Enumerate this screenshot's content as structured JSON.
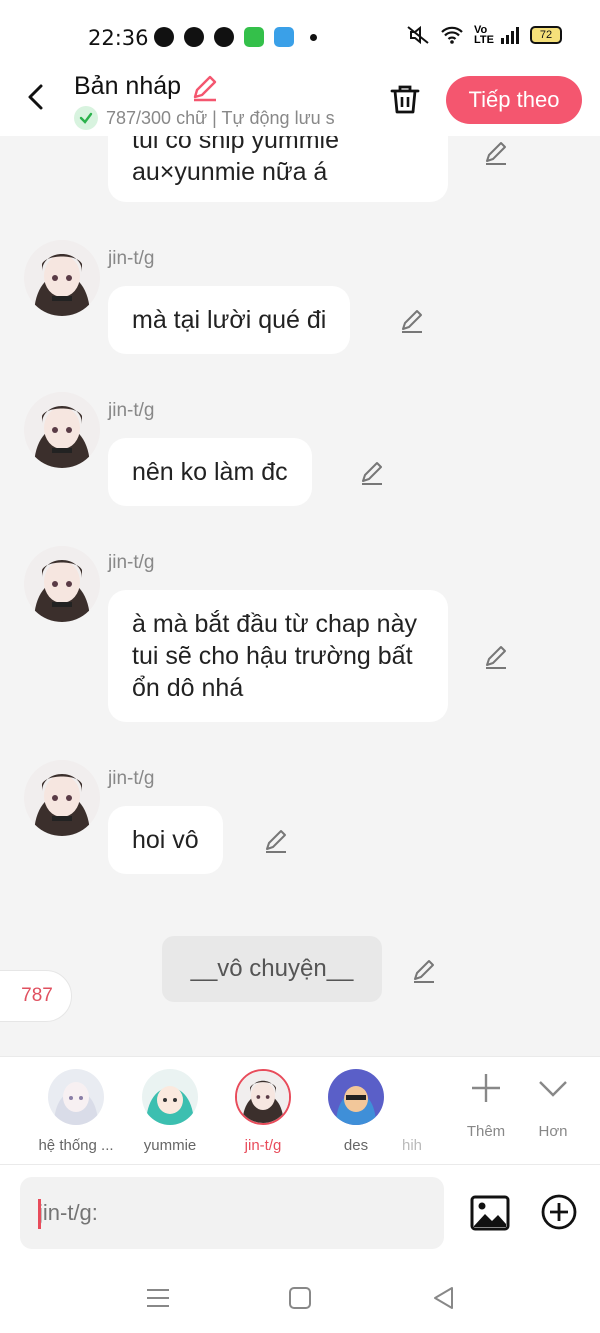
{
  "status_bar": {
    "time": "22:36",
    "battery": "72"
  },
  "header": {
    "title": "Bản nháp",
    "subtitle": "787/300 chữ | Tự động lưu s",
    "next_label": "Tiếp theo"
  },
  "messages": [
    {
      "speaker": "",
      "text": "tui có ship yummie au×yunmie nữa á",
      "partial": true
    },
    {
      "speaker": "jin-t/g",
      "text": "mà tại lười qué đi"
    },
    {
      "speaker": "jin-t/g",
      "text": "nên ko làm đc"
    },
    {
      "speaker": "jin-t/g",
      "text": "à mà bắt đầu từ chap này tui sẽ cho hậu trường bất ổn dô nhá"
    },
    {
      "speaker": "jin-t/g",
      "text": "hoi vô"
    }
  ],
  "narration": "__vô chuyện__",
  "word_counter": "787",
  "characters": [
    {
      "name": "hệ thống ..."
    },
    {
      "name": "yummie"
    },
    {
      "name": "jin-t/g",
      "active": true
    },
    {
      "name": "des"
    },
    {
      "name": "hih"
    }
  ],
  "actions": {
    "more_label": "Thêm",
    "expand_label": "Hơn"
  },
  "input": {
    "placeholder": "jin-t/g:"
  },
  "colors": {
    "accent": "#f4566f",
    "active_char": "#e84c5b",
    "bubble": "#ffffff",
    "background": "#f4f4f4"
  }
}
